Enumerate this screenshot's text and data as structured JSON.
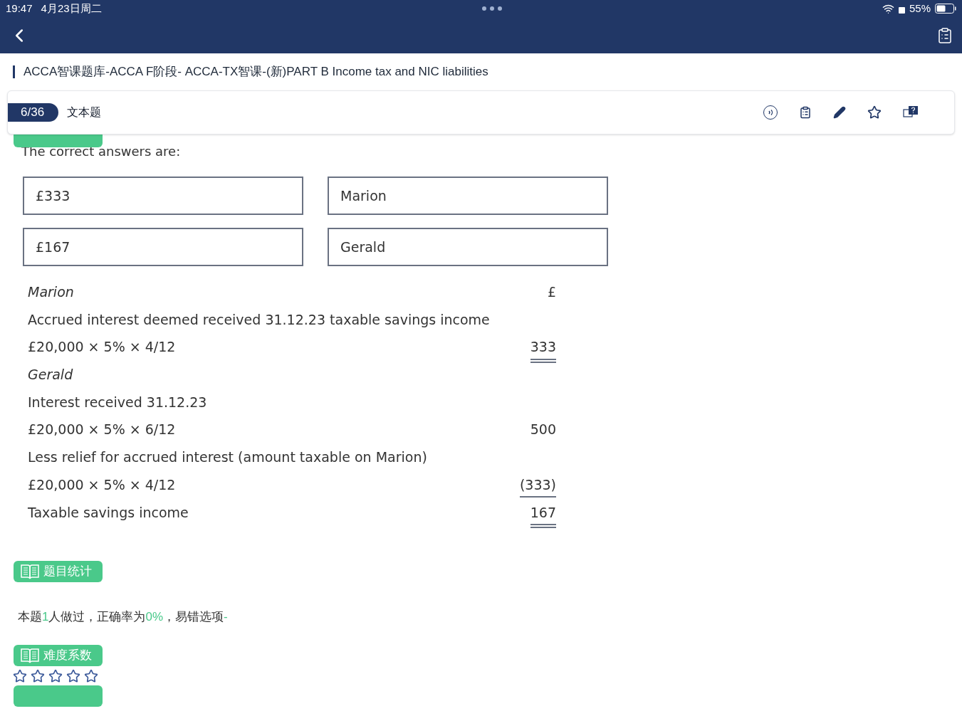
{
  "status_bar": {
    "time": "19:47",
    "date": "4月23日周二",
    "battery": "55%"
  },
  "breadcrumb": "ACCA智课题库-ACCA F阶段- ACCA-TX智课-(新)PART B Income tax and NIC liabilities",
  "toolbar": {
    "counter": "6/36",
    "type": "文本题"
  },
  "answer": {
    "intro": "The correct answers are:",
    "boxes": [
      "£333",
      "Marion",
      "£167",
      "Gerald"
    ],
    "lines": [
      {
        "kind": "heading",
        "text": "Marion",
        "amount": {
          "text": "£",
          "kind": "plain"
        }
      },
      {
        "kind": "text",
        "text": "Accrued interest deemed received 31.12.23 taxable savings income"
      },
      {
        "kind": "text",
        "text": "£20,000 × 5% × 4/12",
        "amount": {
          "text": "333",
          "kind": "double"
        }
      },
      {
        "kind": "heading",
        "text": "Gerald"
      },
      {
        "kind": "text",
        "text": "Interest received 31.12.23"
      },
      {
        "kind": "text",
        "text": "£20,000 × 5% × 6/12",
        "amount": {
          "text": "500",
          "kind": "plain"
        }
      },
      {
        "kind": "text",
        "text": "Less relief for accrued interest (amount taxable on Marion)"
      },
      {
        "kind": "text",
        "text": "£20,000 × 5% × 4/12",
        "amount": {
          "text": "(333)",
          "kind": "single"
        }
      },
      {
        "kind": "text",
        "text": "Taxable savings income",
        "amount": {
          "text": "167",
          "kind": "double"
        }
      }
    ]
  },
  "stats": {
    "label": "题目统计",
    "parts": [
      {
        "text": "本题",
        "highlight": false
      },
      {
        "text": "1",
        "highlight": true
      },
      {
        "text": "人做过，正确率为",
        "highlight": false
      },
      {
        "text": "0%",
        "highlight": true
      },
      {
        "text": "，易错选项",
        "highlight": false
      },
      {
        "text": "-",
        "highlight": true
      }
    ]
  },
  "difficulty": {
    "label": "难度系数",
    "stars": 0
  }
}
